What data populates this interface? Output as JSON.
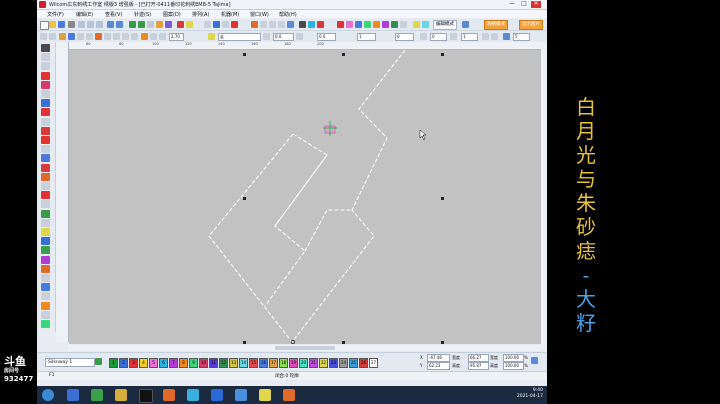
{
  "window": {
    "title": "Wilcom広东刺绣工作室  绣版3  增强版  - [已打开-0411番印花刺绣EMB-5   Tajima]",
    "minimize": "—",
    "maximize": "□",
    "close": "✕"
  },
  "menu": [
    "文件(F)",
    "编辑(E)",
    "查看(V)",
    "针迹(S)",
    "图案(D)",
    "排列(A)",
    "机器(M)",
    "窗口(W)",
    "帮助(H)"
  ],
  "toolbar2": {
    "stitch_field": "走",
    "value_a": "0.0",
    "value_b": "1",
    "value_c": "0",
    "mode_button": "编辑模式",
    "insert_button": "刺绣模式",
    "show_button": "显示图片"
  },
  "toolbar3": {
    "width_a": "2.70",
    "width_b": "0.0",
    "val_c": "0",
    "val_d": "1",
    "val_e": "5"
  },
  "ruler_labels": [
    "60",
    "80",
    "100",
    "120",
    "140",
    "160",
    "180",
    "200"
  ],
  "thread_combo": "Silknway 1",
  "color_swatches": [
    {
      "label": "1",
      "color": "#1c9a3a"
    },
    {
      "label": "2",
      "color": "#3a6fd6"
    },
    {
      "label": "3",
      "color": "#e03232"
    },
    {
      "label": "4",
      "color": "#f0d21e"
    },
    {
      "label": "5",
      "color": "#e96fd2"
    },
    {
      "label": "6",
      "color": "#2bb3e0"
    },
    {
      "label": "7",
      "color": "#b23ad6"
    },
    {
      "label": "8",
      "color": "#f08a1e"
    },
    {
      "label": "9",
      "color": "#3ad67a"
    },
    {
      "label": "10",
      "color": "#d63a6a"
    },
    {
      "label": "11",
      "color": "#5a3ad6"
    },
    {
      "label": "12",
      "color": "#2f8f4f"
    },
    {
      "label": "13",
      "color": "#d6c43a"
    },
    {
      "label": "14",
      "color": "#6ad6e0"
    },
    {
      "label": "15",
      "color": "#e04a4a"
    },
    {
      "label": "16",
      "color": "#4a7ae0"
    },
    {
      "label": "17",
      "color": "#e0a04a"
    },
    {
      "label": "18",
      "color": "#8ae04a"
    },
    {
      "label": "19",
      "color": "#e04ab8"
    },
    {
      "label": "20",
      "color": "#4ae0c0"
    },
    {
      "label": "21",
      "color": "#c04ae0"
    },
    {
      "label": "22",
      "color": "#e0d84a"
    },
    {
      "label": "23",
      "color": "#4a4ae0"
    },
    {
      "label": "24",
      "color": "#9a9a9a"
    },
    {
      "label": "25",
      "color": "#3aa0d6"
    },
    {
      "label": "26",
      "color": "#d63a3a"
    },
    {
      "label": "27",
      "color": "#ffffff"
    }
  ],
  "coords": {
    "x_label": "X",
    "x_value": "-67.46",
    "y_label": "Y",
    "y_value": "62.23",
    "w_label": "宽度",
    "w_value": "66.27",
    "h_label": "高度",
    "h_value": "95.87",
    "sx_label": "宽度",
    "sx_value": "100.00",
    "sy_label": "高度",
    "sy_value": "100.00",
    "unit": "%"
  },
  "status": {
    "left": "F1",
    "mid": "闭合:0 轮廓"
  },
  "taskbar": {
    "time": "9:40",
    "date": "2021-04-17"
  },
  "overlay": {
    "title_chars": [
      "白",
      "月",
      "光",
      "与",
      "朱",
      "砂",
      "痣",
      "-",
      "大",
      "籽"
    ],
    "logo_big": "斗鱼",
    "logo_small": "房间号",
    "room_id": "932477"
  },
  "colors": {
    "title_gold": "#e6c23a",
    "title_blue": "#4aa3e6",
    "canvas_bg": "#c2c2c2",
    "stitch": "#ffffff"
  }
}
